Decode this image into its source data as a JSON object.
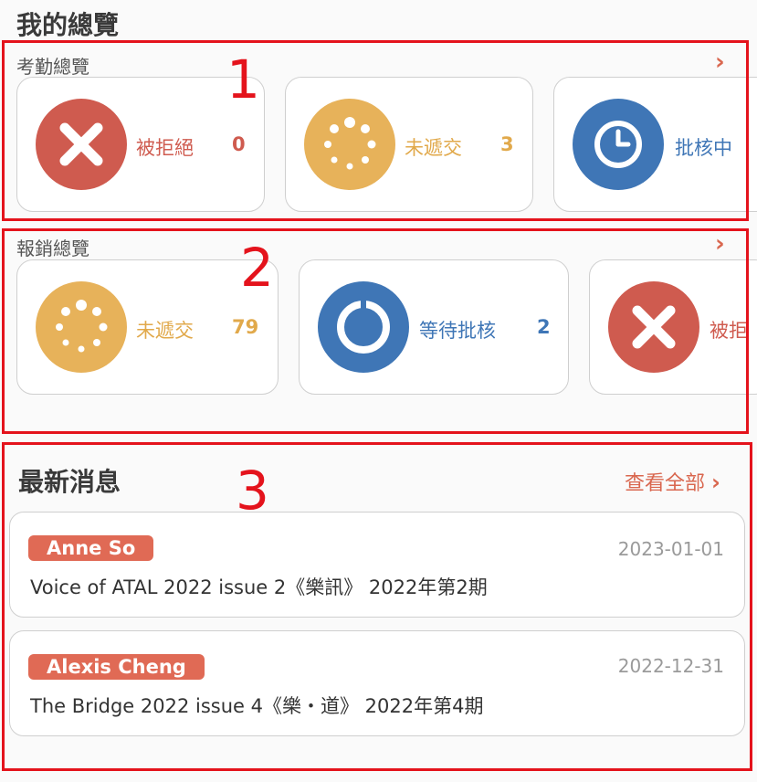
{
  "page": {
    "title": "我的總覽"
  },
  "annotations": [
    "1",
    "2",
    "3"
  ],
  "attendance": {
    "title": "考勤總覽",
    "cards": [
      {
        "label": "被拒絕",
        "count": "0",
        "icon": "close-icon",
        "color": "#cf5b4f"
      },
      {
        "label": "未遞交",
        "count": "3",
        "icon": "loading-icon",
        "color": "#e7b25a"
      },
      {
        "label": "批核中",
        "count": "",
        "icon": "clock-icon",
        "color": "#3f76b6"
      }
    ]
  },
  "expense": {
    "title": "報銷總覽",
    "cards": [
      {
        "label": "未遞交",
        "count": "79",
        "icon": "loading-icon",
        "color": "#e7b25a"
      },
      {
        "label": "等待批核",
        "count": "2",
        "icon": "power-ring-icon",
        "color": "#3f76b6"
      },
      {
        "label": "被拒",
        "count": "",
        "icon": "close-icon",
        "color": "#cf5b4f"
      }
    ]
  },
  "news": {
    "title": "最新消息",
    "view_all": "查看全部",
    "items": [
      {
        "author": "Anne So",
        "date": "2023-01-01",
        "text": "Voice of ATAL 2022 issue 2《樂訊》 2022年第2期"
      },
      {
        "author": "Alexis Cheng",
        "date": "2022-12-31",
        "text": "The Bridge 2022 issue 4《樂・道》 2022年第4期"
      }
    ]
  }
}
